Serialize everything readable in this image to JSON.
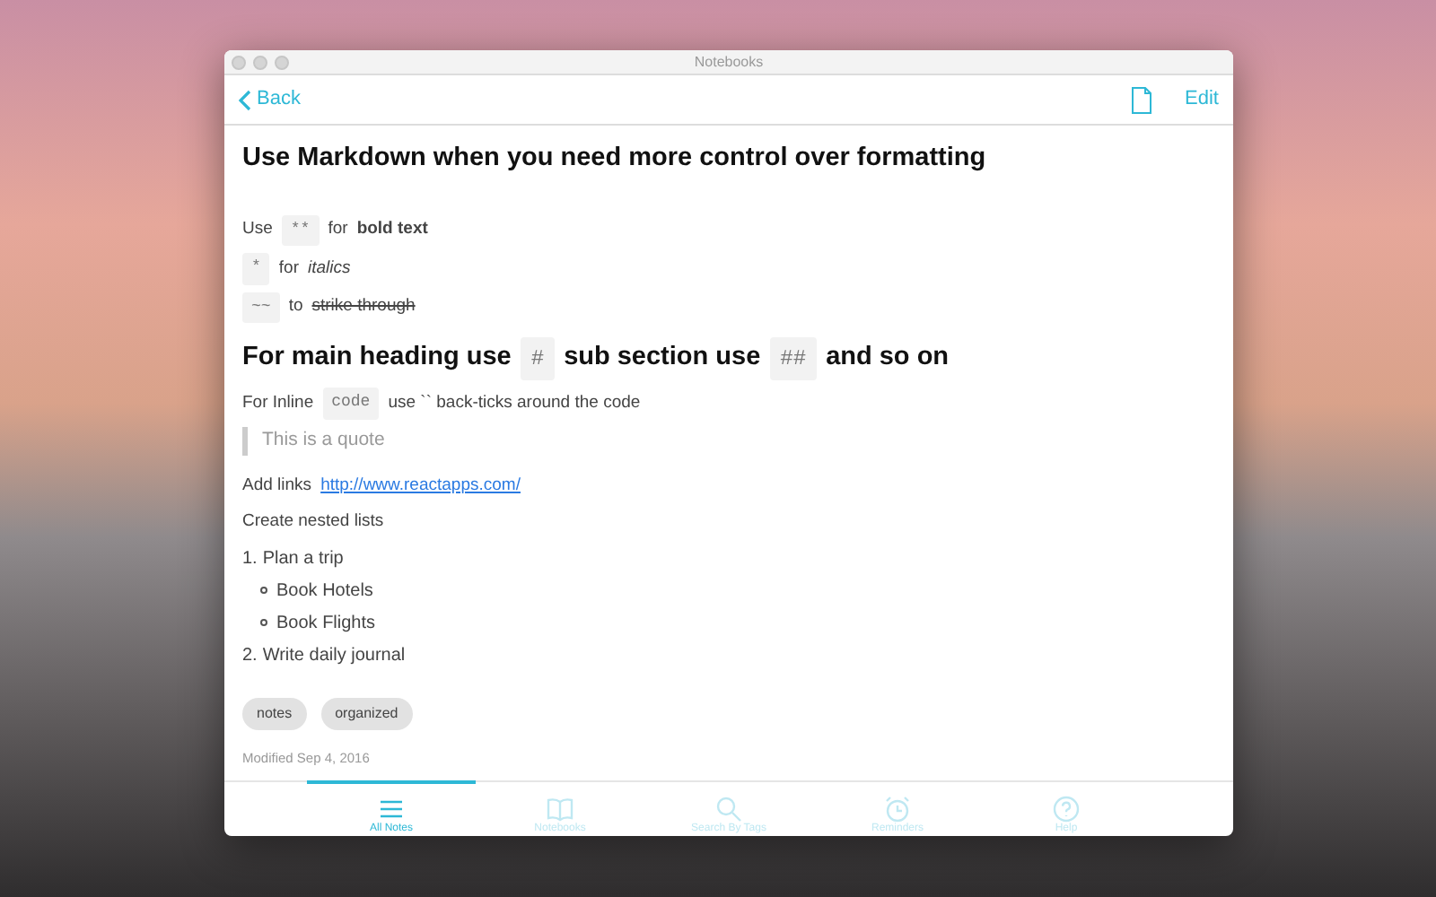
{
  "window": {
    "title": "Notebooks"
  },
  "navbar": {
    "back": "Back",
    "edit": "Edit"
  },
  "note": {
    "title": "Use Markdown when you need more control over formatting",
    "blocks": [
      {
        "kind": "para",
        "parts": [
          {
            "kind": "text",
            "text": "Use"
          },
          {
            "kind": "code",
            "text": "**"
          },
          {
            "kind": "text",
            "text": "for"
          },
          {
            "kind": "bold",
            "text": "bold text"
          }
        ]
      },
      {
        "kind": "para",
        "parts": [
          {
            "kind": "code",
            "text": "*"
          },
          {
            "kind": "text",
            "text": "for"
          },
          {
            "kind": "italic",
            "text": "italics"
          }
        ]
      },
      {
        "kind": "para",
        "parts": [
          {
            "kind": "code",
            "text": "~~"
          },
          {
            "kind": "text",
            "text": "to"
          },
          {
            "kind": "strike",
            "text": "strike through"
          }
        ]
      },
      {
        "kind": "heading",
        "parts": [
          {
            "kind": "text",
            "text": "For main heading use"
          },
          {
            "kind": "code",
            "text": "#"
          },
          {
            "kind": "text",
            "text": "sub section use"
          },
          {
            "kind": "code",
            "text": "##"
          },
          {
            "kind": "text",
            "text": "and so on"
          }
        ]
      },
      {
        "kind": "para",
        "parts": [
          {
            "kind": "text",
            "text": "For Inline"
          },
          {
            "kind": "code",
            "text": "code"
          },
          {
            "kind": "text",
            "text": "use `` back-ticks around the code"
          }
        ]
      },
      {
        "kind": "quote",
        "text": "This is a quote"
      },
      {
        "kind": "para",
        "parts": [
          {
            "kind": "text",
            "text": "Add links"
          },
          {
            "kind": "link",
            "text": "http://www.reactapps.com/"
          }
        ]
      },
      {
        "kind": "para",
        "parts": [
          {
            "kind": "text",
            "text": "Create nested lists"
          }
        ]
      },
      {
        "kind": "list",
        "items": [
          {
            "marker": "1.",
            "text": "Plan a trip",
            "children": [
              {
                "text": "Book Hotels"
              },
              {
                "text": "Book Flights"
              }
            ]
          },
          {
            "marker": "2.",
            "text": "Write daily journal"
          }
        ]
      }
    ],
    "tags": [
      "notes",
      "organized"
    ],
    "modified": "Modified Sep 4, 2016"
  },
  "tabs": [
    {
      "kind": "list",
      "label": "All Notes",
      "selected": true
    },
    {
      "kind": "book",
      "label": "Notebooks",
      "selected": false
    },
    {
      "kind": "search",
      "label": "Search By Tags",
      "selected": false
    },
    {
      "kind": "alarm",
      "label": "Reminders",
      "selected": false
    },
    {
      "kind": "help",
      "label": "Help",
      "selected": false
    }
  ]
}
